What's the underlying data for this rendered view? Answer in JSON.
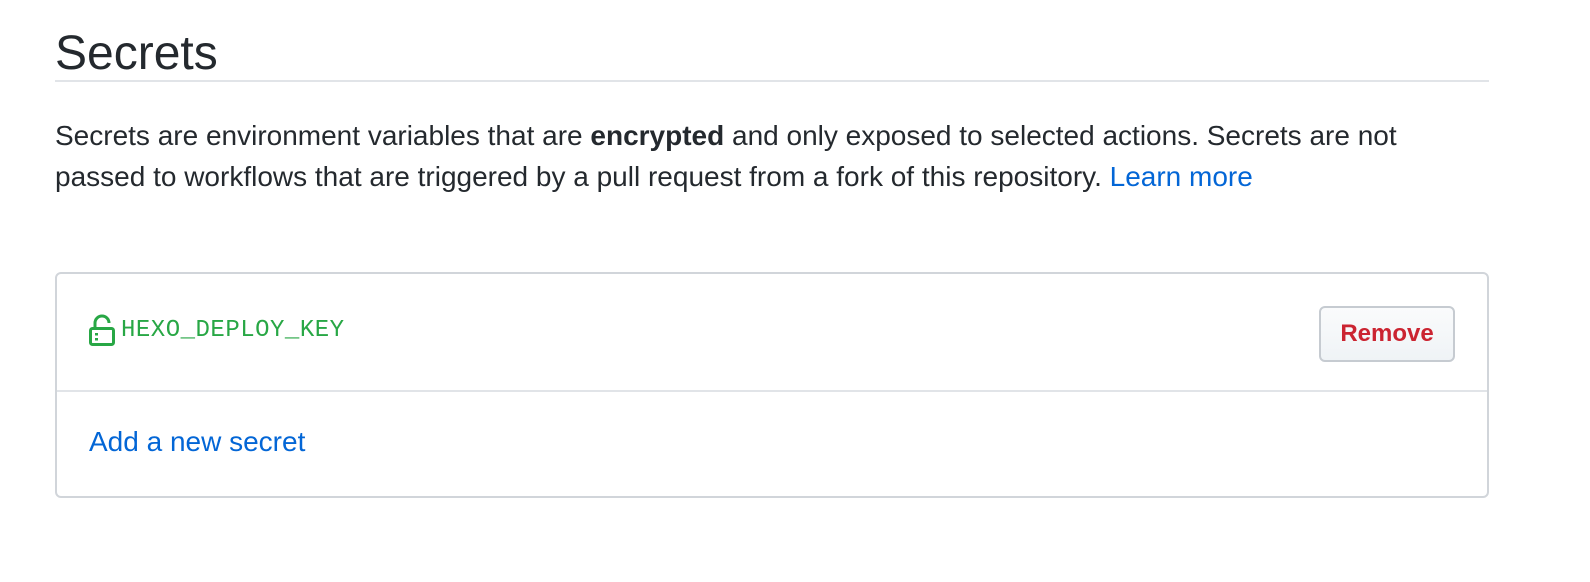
{
  "header": {
    "title": "Secrets"
  },
  "description": {
    "text_before": "Secrets are environment variables that are ",
    "emphasis": "encrypted",
    "text_after": " and only exposed to selected actions. Secrets are not passed to workflows that are triggered by a pull request from a fork of this repository. ",
    "link_label": "Learn more"
  },
  "secrets": {
    "items": [
      {
        "name": "HEXO_DEPLOY_KEY",
        "icon": "lock-icon",
        "remove_label": "Remove"
      }
    ],
    "add_label": "Add a new secret"
  },
  "colors": {
    "link": "#0366d6",
    "secret_name": "#28a745",
    "danger": "#cb2431",
    "border": "#d1d5da"
  }
}
